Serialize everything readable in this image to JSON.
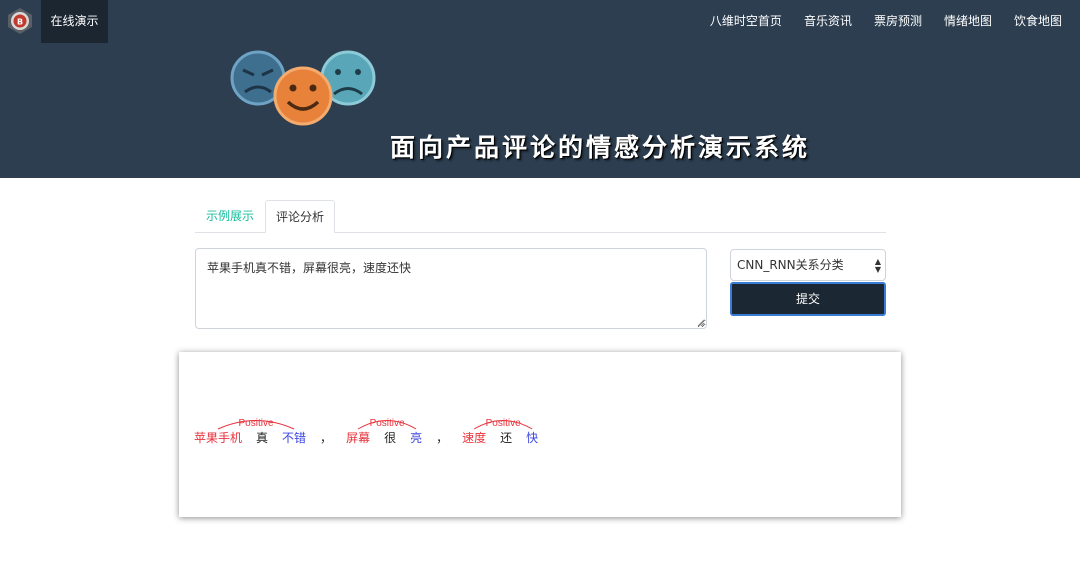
{
  "navbar": {
    "brand": "在线演示",
    "logo_icon": "lab-logo-icon",
    "items": [
      {
        "label": "八维时空首页"
      },
      {
        "label": "音乐资讯"
      },
      {
        "label": "票房预测"
      },
      {
        "label": "情绪地图"
      },
      {
        "label": "饮食地图"
      }
    ]
  },
  "banner": {
    "title": "面向产品评论的情感分析演示系统",
    "faces_icon": "emotion-faces-icon"
  },
  "tabs": [
    {
      "label": "示例展示",
      "active": false
    },
    {
      "label": "评论分析",
      "active": true
    }
  ],
  "form": {
    "review_text": "苹果手机真不错，屏幕很亮，速度还快",
    "model_select": "CNN_RNN关系分类",
    "submit_label": "提交"
  },
  "result": {
    "tokens": [
      {
        "text": "苹果手机",
        "role": "aspect"
      },
      {
        "text": "真",
        "role": "other"
      },
      {
        "text": "不错",
        "role": "opinion"
      },
      {
        "text": "，",
        "role": "other"
      },
      {
        "text": "屏幕",
        "role": "aspect"
      },
      {
        "text": "很",
        "role": "other"
      },
      {
        "text": "亮",
        "role": "opinion"
      },
      {
        "text": "，",
        "role": "other"
      },
      {
        "text": "速度",
        "role": "aspect"
      },
      {
        "text": "还",
        "role": "other"
      },
      {
        "text": "快",
        "role": "opinion"
      }
    ],
    "relations": [
      {
        "from": 0,
        "to": 2,
        "label": "Positive"
      },
      {
        "from": 4,
        "to": 6,
        "label": "Positive"
      },
      {
        "from": 8,
        "to": 10,
        "label": "Positive"
      }
    ]
  },
  "colors": {
    "header_bg": "#2c3e50",
    "brand_bg": "#1c2630",
    "accent_green": "#18bc9c",
    "aspect_red": "#e8323c",
    "opinion_blue": "#3c47e0",
    "submit_bg": "#1b2733"
  }
}
